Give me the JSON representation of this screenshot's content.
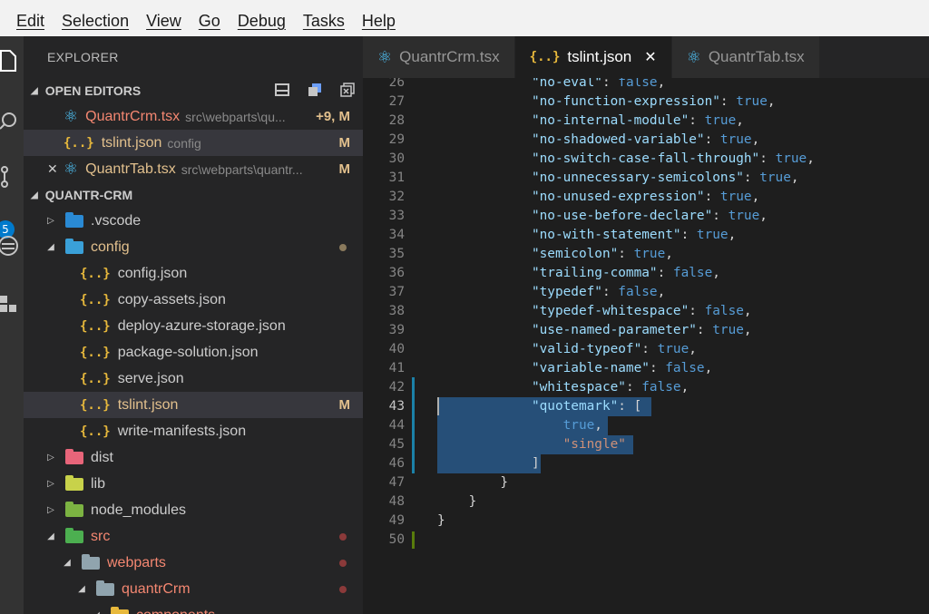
{
  "menu": [
    "Edit",
    "Selection",
    "View",
    "Go",
    "Debug",
    "Tasks",
    "Help"
  ],
  "activity": {
    "badge": "5"
  },
  "sidebar": {
    "title": "EXPLORER",
    "open_editors": {
      "header": "OPEN EDITORS",
      "items": [
        {
          "name": "QuantrCrm.tsx",
          "desc": "src\\webparts\\qu...",
          "status": "+9, M",
          "name_color": "#f48771",
          "status_color": "#e2c08d"
        },
        {
          "name": "tslint.json",
          "desc": "config",
          "status": "M",
          "name_color": "#e2c08d",
          "status_color": "#e2c08d"
        },
        {
          "name": "QuantrTab.tsx",
          "desc": "src\\webparts\\quantr...",
          "status": "M",
          "name_color": "#e2c08d",
          "status_color": "#e2c08d"
        }
      ]
    },
    "project": {
      "header": "QUANTR-CRM",
      "items": [
        {
          "name": ".vscode"
        },
        {
          "name": "config"
        },
        {
          "name": "config.json"
        },
        {
          "name": "copy-assets.json"
        },
        {
          "name": "deploy-azure-storage.json"
        },
        {
          "name": "package-solution.json"
        },
        {
          "name": "serve.json"
        },
        {
          "name": "tslint.json",
          "status": "M"
        },
        {
          "name": "write-manifests.json"
        },
        {
          "name": "dist"
        },
        {
          "name": "lib"
        },
        {
          "name": "node_modules"
        },
        {
          "name": "src"
        },
        {
          "name": "webparts"
        },
        {
          "name": "quantrCrm"
        },
        {
          "name": "components"
        }
      ]
    }
  },
  "tabs": [
    {
      "label": "QuantrCrm.tsx"
    },
    {
      "label": "tslint.json"
    },
    {
      "label": "QuantrTab.tsx"
    }
  ],
  "editor": {
    "lines": [
      {
        "n": "26",
        "key": "\"no-eval\"",
        "val": "false"
      },
      {
        "n": "27",
        "key": "\"no-function-expression\"",
        "val": "true"
      },
      {
        "n": "28",
        "key": "\"no-internal-module\"",
        "val": "true"
      },
      {
        "n": "29",
        "key": "\"no-shadowed-variable\"",
        "val": "true"
      },
      {
        "n": "30",
        "key": "\"no-switch-case-fall-through\"",
        "val": "true"
      },
      {
        "n": "31",
        "key": "\"no-unnecessary-semicolons\"",
        "val": "true"
      },
      {
        "n": "32",
        "key": "\"no-unused-expression\"",
        "val": "true"
      },
      {
        "n": "33",
        "key": "\"no-use-before-declare\"",
        "val": "true"
      },
      {
        "n": "34",
        "key": "\"no-with-statement\"",
        "val": "true"
      },
      {
        "n": "35",
        "key": "\"semicolon\"",
        "val": "true"
      },
      {
        "n": "36",
        "key": "\"trailing-comma\"",
        "val": "false"
      },
      {
        "n": "37",
        "key": "\"typedef\"",
        "val": "false"
      },
      {
        "n": "38",
        "key": "\"typedef-whitespace\"",
        "val": "false"
      },
      {
        "n": "39",
        "key": "\"use-named-parameter\"",
        "val": "true"
      },
      {
        "n": "40",
        "key": "\"valid-typeof\"",
        "val": "true"
      },
      {
        "n": "41",
        "key": "\"variable-name\"",
        "val": "false"
      },
      {
        "n": "42",
        "key": "\"whitespace\"",
        "val": "false"
      },
      {
        "n": "43",
        "key": "\"quotemark\"",
        "val": ""
      },
      {
        "n": "44",
        "key": "",
        "val": "true"
      },
      {
        "n": "45",
        "key": "",
        "val": "\"single\""
      },
      {
        "n": "46",
        "key": "",
        "val": "]"
      },
      {
        "n": "47",
        "key": "",
        "val": "}"
      },
      {
        "n": "48",
        "key": "",
        "val": "}"
      },
      {
        "n": "49",
        "key": "",
        "val": "}"
      },
      {
        "n": "50",
        "key": "",
        "val": ""
      }
    ]
  },
  "colors": {
    "accent": "#007acc",
    "modified": "#e2c08d",
    "error": "#f48771",
    "selection": "#264f78"
  }
}
